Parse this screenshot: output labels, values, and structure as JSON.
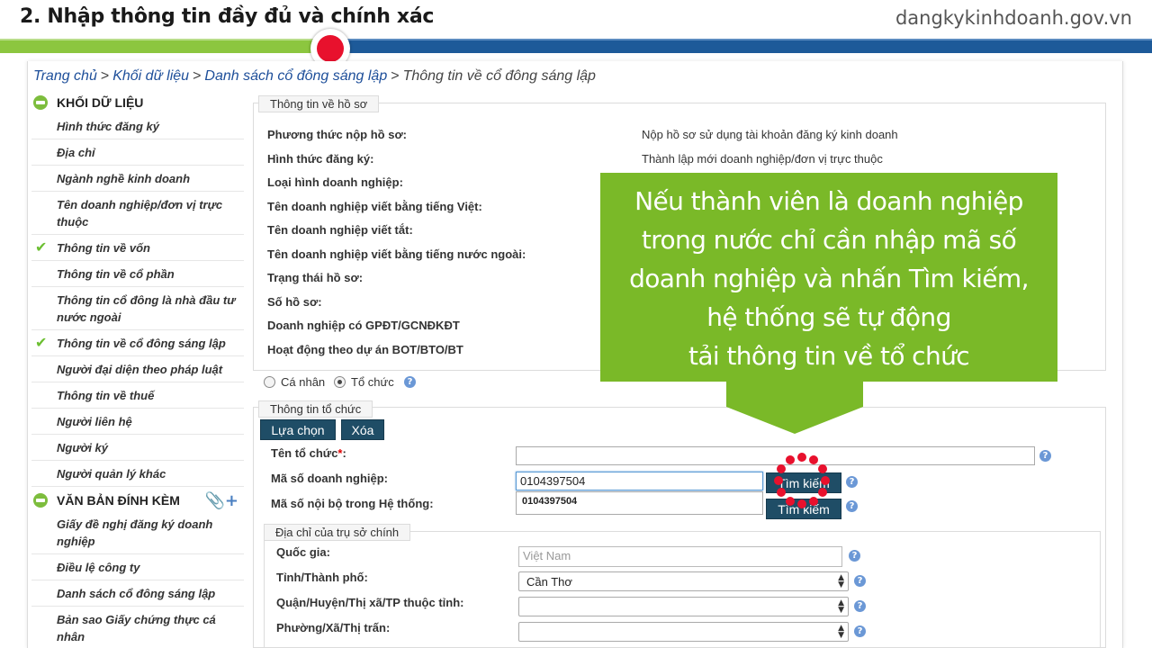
{
  "banner": {
    "title": "2. Nhập thông tin đầy đủ và chính xác",
    "site": "dangkykinhdoanh.gov.vn",
    "progress_percent": 29
  },
  "breadcrumb": {
    "items": [
      "Trang chủ",
      "Khối dữ liệu",
      "Danh sách cổ đông sáng lập"
    ],
    "current": "Thông tin về cổ đông sáng lập",
    "separator": ">"
  },
  "sidebar": {
    "data_header": "KHỐI DỮ LIỆU",
    "data_items": [
      {
        "label": "Hình thức đăng ký",
        "checked": false
      },
      {
        "label": "Địa chỉ",
        "checked": false
      },
      {
        "label": "Ngành nghề kinh doanh",
        "checked": false
      },
      {
        "label": "Tên doanh nghiệp/đơn vị trực thuộc",
        "checked": false
      },
      {
        "label": "Thông tin về vốn",
        "checked": true
      },
      {
        "label": "Thông tin về cổ phần",
        "checked": false
      },
      {
        "label": "Thông tin cổ đông là nhà đầu tư nước ngoài",
        "checked": false
      },
      {
        "label": "Thông tin về cổ đông sáng lập",
        "checked": true
      },
      {
        "label": "Người đại diện theo pháp luật",
        "checked": false
      },
      {
        "label": "Thông tin về thuế",
        "checked": false
      },
      {
        "label": "Người liên hệ",
        "checked": false
      },
      {
        "label": "Người ký",
        "checked": false
      },
      {
        "label": "Người quản lý khác",
        "checked": false
      }
    ],
    "attach_header": "VĂN BẢN ĐÍNH KÈM",
    "attach_items": [
      {
        "label": "Giấy đề nghị đăng ký doanh nghiệp"
      },
      {
        "label": "Điều lệ công ty"
      },
      {
        "label": "Danh sách cổ đông sáng lập"
      },
      {
        "label": "Bản sao Giấy chứng thực cá nhân"
      }
    ]
  },
  "profile": {
    "legend": "Thông tin về hồ sơ",
    "rows": [
      {
        "label": "Phương thức nộp hồ sơ:",
        "value": "Nộp hồ sơ sử dụng tài khoản đăng ký kinh doanh"
      },
      {
        "label": "Hình thức đăng ký:",
        "value": "Thành lập mới doanh nghiệp/đơn vị trực thuộc"
      },
      {
        "label": "Loại hình doanh nghiệp:",
        "value": ""
      },
      {
        "label": "Tên doanh nghiệp viết bằng tiếng Việt:",
        "value": ""
      },
      {
        "label": "Tên doanh nghiệp viết tắt:",
        "value": ""
      },
      {
        "label": "Tên doanh nghiệp viết bằng tiếng nước ngoài:",
        "value": ""
      },
      {
        "label": "Trạng thái hồ sơ:",
        "value": ""
      },
      {
        "label": "Số hồ sơ:",
        "value": ""
      },
      {
        "label": "Doanh nghiệp có GPĐT/GCNĐKĐT",
        "value": ""
      },
      {
        "label": "Hoạt động theo dự án BOT/BTO/BT",
        "value": ""
      }
    ]
  },
  "member_type": {
    "individual": "Cá nhân",
    "organization": "Tổ chức",
    "selected": "organization",
    "help": "?"
  },
  "org": {
    "legend": "Thông tin tổ chức",
    "select_button": "Lựa chọn",
    "delete_button": "Xóa",
    "name_label": "Tên tổ chức",
    "required_mark": "*",
    "name_value": "",
    "code_label": "Mã số doanh nghiệp:",
    "code_value": "0104397504",
    "suggestion": "0104397504",
    "internal_label": "Mã số nội bộ trong Hệ thống:",
    "search_button": "Tìm kiếm",
    "search_button_2": "Tìm kiếm"
  },
  "address": {
    "legend": "Địa chỉ của trụ sở chính",
    "country_label": "Quốc gia:",
    "country_placeholder": "Việt Nam",
    "province_label": "Tỉnh/Thành phố:",
    "province_value": "Cần Thơ",
    "district_label": "Quận/Huyện/Thị xã/TP thuộc tỉnh:",
    "district_value": "",
    "ward_label": "Phường/Xã/Thị trấn:",
    "ward_value": ""
  },
  "callout": {
    "lines": [
      "Nếu thành viên là doanh nghiệp",
      "trong nước chỉ cần nhập mã số",
      "doanh nghiệp và nhấn Tìm kiếm,",
      "hệ thống sẽ tự động",
      "tải thông tin về tổ chức"
    ]
  },
  "colors": {
    "accent_green": "#7ab928",
    "progress_blue": "#1d5a99",
    "marker_red": "#e8112d",
    "link_blue": "#1e4f9a",
    "button_dark": "#1f4d66"
  }
}
